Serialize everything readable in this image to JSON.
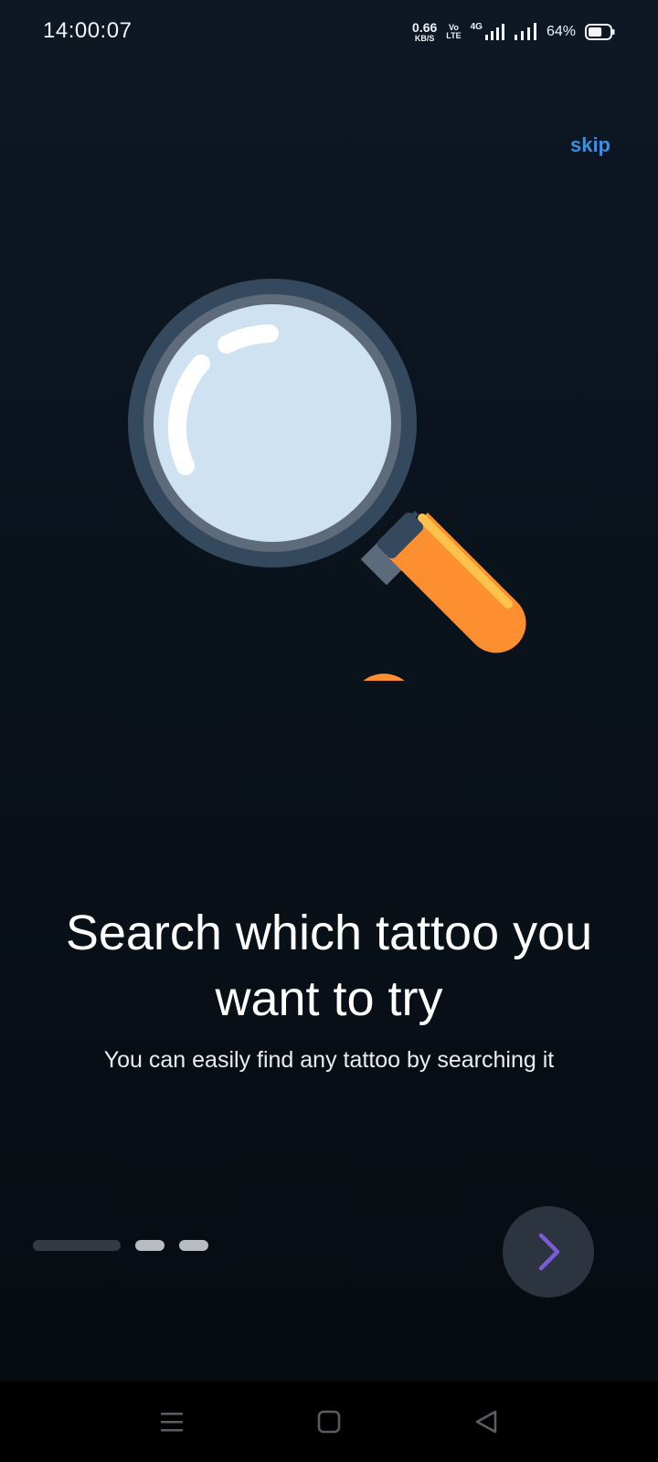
{
  "status_bar": {
    "time": "14:00:07",
    "net_speed_value": "0.66",
    "net_speed_unit": "KB/S",
    "volte_top": "Vo",
    "volte_bottom": "LTE",
    "network_type": "4G",
    "battery_percent": "64%",
    "battery_level": 0.64
  },
  "onboarding": {
    "skip_label": "skip",
    "headline": "Search which tattoo you want to try",
    "subtitle": "You can easily find any tattoo by searching it",
    "illustration_icon": "magnifying-glass-icon",
    "page_count": 3,
    "current_page": 1,
    "next_icon": "chevron-right-icon"
  },
  "colors": {
    "accent_link": "#3b8fe0",
    "next_chevron": "#7b5cd6",
    "magnifier_rim": "#34495e",
    "magnifier_lens": "#cfe2f1",
    "magnifier_handle": "#fd8f31"
  },
  "nav_bar": {
    "menu_icon": "menu-icon",
    "home_icon": "home-square-icon",
    "back_icon": "back-triangle-icon"
  }
}
